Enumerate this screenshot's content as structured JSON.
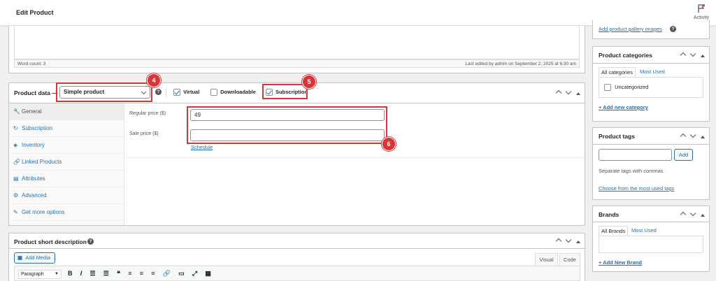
{
  "header": {
    "title": "Edit Product",
    "activity_label": "Activity"
  },
  "editor": {
    "word_count": "Word count: 3",
    "last_edited": "Last edited by admin on September 2, 2025 at 6:30 am"
  },
  "product_data": {
    "title": "Product data —",
    "type_selected": "Simple product",
    "virtual_label": "Virtual",
    "virtual_checked": true,
    "downloadable_label": "Downloadable",
    "downloadable_checked": false,
    "subscription_label": "Subscription",
    "subscription_checked": true,
    "tabs": [
      {
        "label": "General",
        "icon": "wrench-icon",
        "glyph": "🔧"
      },
      {
        "label": "Subscription",
        "icon": "refresh-icon",
        "glyph": "↻"
      },
      {
        "label": "Inventory",
        "icon": "tag-icon",
        "glyph": "◈"
      },
      {
        "label": "Linked Products",
        "icon": "link-icon",
        "glyph": "🔗"
      },
      {
        "label": "Attributes",
        "icon": "list-icon",
        "glyph": "▤"
      },
      {
        "label": "Advanced",
        "icon": "gear-icon",
        "glyph": "⚙"
      },
      {
        "label": "Get more options",
        "icon": "plugin-icon",
        "glyph": "✎"
      }
    ],
    "regular_price_label": "Regular price ($)",
    "regular_price_value": "49",
    "sale_price_label": "Sale price ($)",
    "sale_price_value": "",
    "schedule_link": "Schedule"
  },
  "annotations": [
    "4",
    "5",
    "6"
  ],
  "short_description": {
    "title": "Product short description",
    "add_media": "Add Media",
    "tab_visual": "Visual",
    "tab_code": "Code",
    "format_select": "Paragraph"
  },
  "sidebar": {
    "gallery_link": "Add product gallery images",
    "categories": {
      "title": "Product categories",
      "tab_all": "All categories",
      "tab_most": "Most Used",
      "items": [
        "Uncategorized"
      ],
      "add_new": "+ Add new category"
    },
    "tags": {
      "title": "Product tags",
      "add_button": "Add",
      "hint": "Separate tags with commas",
      "choose_link": "Choose from the most used tags"
    },
    "brands": {
      "title": "Brands",
      "tab_all": "All Brands",
      "tab_most": "Most Used",
      "add_new": "+ Add New Brand"
    }
  },
  "colors": {
    "accent": "#2271b1",
    "annotation": "#d63638"
  }
}
